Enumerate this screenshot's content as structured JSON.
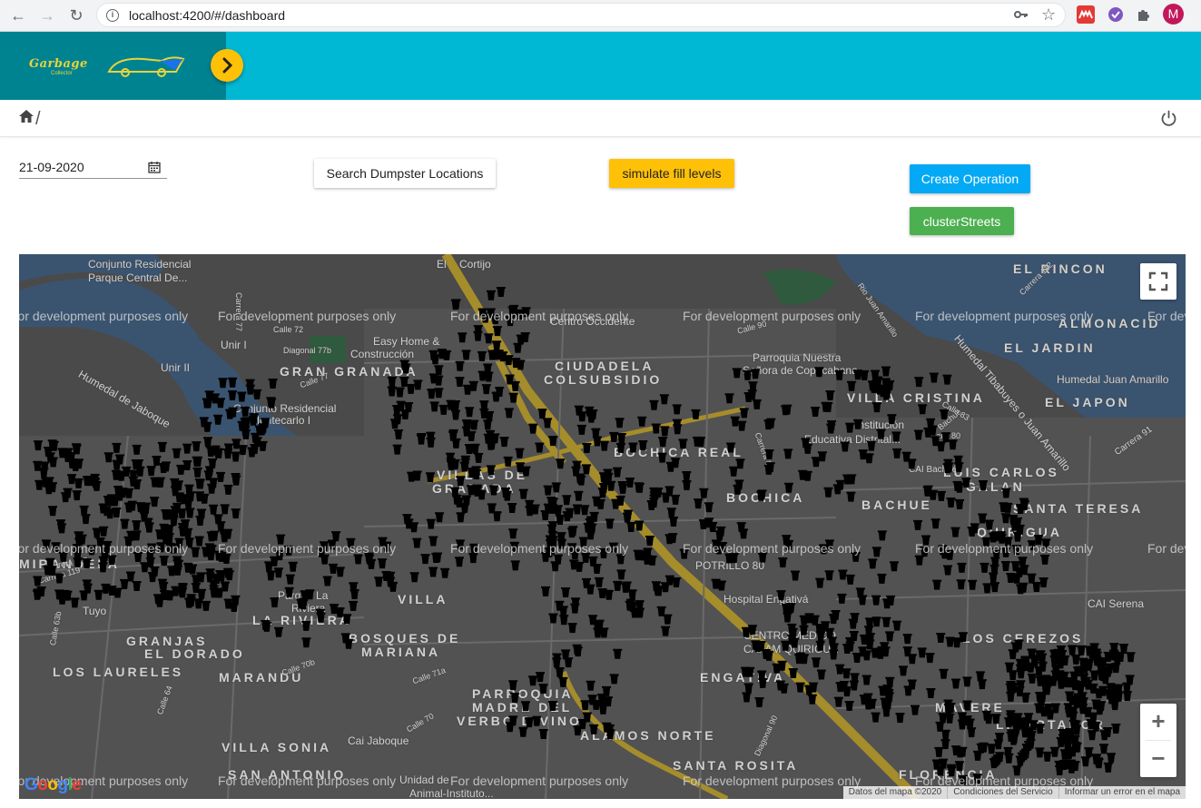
{
  "browser": {
    "url": "localhost:4200/#/dashboard",
    "profile_initial": "M"
  },
  "header": {
    "logo_text": "Garbage",
    "logo_subtext": "Collector"
  },
  "controls": {
    "date_value": "21-09-2020",
    "search_label": "Search Dumpster Locations",
    "simulate_label": "simulate fill levels",
    "create_label": "Create Operation",
    "cluster_label": "clusterStreets"
  },
  "map": {
    "watermark": "For development purposes only",
    "neighborhoods": [
      "EL RINCON",
      "ALMONACID",
      "EL JARDIN",
      "EL JAPON",
      "GRAN GRANADA",
      "CIUDADELA",
      "COLSUBSIDIO",
      "VILLA CRISTINA",
      "LUIS CARLOS",
      "GALAN",
      "SANTA TERESA",
      "BOCHICA",
      "BACHUE",
      "QUIRIGUA",
      "LOS LAURELES",
      "GRANJAS",
      "EL DORADO",
      "MARANDU",
      "BOSQUES DE",
      "MARIANA",
      "VILLAS DE",
      "GRANADA",
      "PARROQUIA",
      "MADRE DEL",
      "VERBO DIVINO",
      "ALAMOS NORTE",
      "ENGATIVA",
      "VILLA SONIA",
      "SAN ANTONIO",
      "SANTA ROSITA",
      "LOS CEREZOS",
      "MAVERE",
      "FLORENCIA",
      "LIBERTADOR",
      "MIRANDELA",
      "LA RIVIERA",
      "VILLA",
      "BOCHICA REAL"
    ],
    "places": [
      "Conjunto Residencial",
      "Parque Central De...",
      "Humedal de Jaboque",
      "Easy Home &",
      "Construcción",
      "Unir II",
      "Conjunto Residencial",
      "Montecarlo I",
      "Calle 77",
      "Diagonal 77b",
      "Parroquia Nuestra",
      "Señora de Copacabana",
      "Humedal Juan Amarillo",
      "Institución",
      "Educativa Distrital...",
      "CAI Bachué",
      "Parque La",
      "Riviera",
      "Tuyo",
      "Cai Jaboque",
      "CAI Serena",
      "Hospital Engativá",
      "CENTRO MEDICO",
      "CAFAM QUIRIGUA",
      "POTRILLO 80",
      "Unidad de",
      "Animal-Instituto...",
      "Humedal Tibabuyes o Juan Amarillo",
      "Carrera 91",
      "Calle 63b",
      "Calle 64",
      "Calle 70",
      "Carrera 119",
      "Carrera 116",
      "Diagonal 90",
      "Calle 80",
      "Calle 72",
      "Calle 70b",
      "Calle 71a",
      "Carrera 77",
      "Carrera 86",
      "Bachué",
      "Rio Juan Amarillo",
      "Calle 90",
      "Carrera 112",
      "Calle 83",
      "Unir I",
      "Centro Occidente",
      "Cortijo",
      "El"
    ],
    "google_logo": "Google",
    "attribution": [
      "Datos del mapa ©2020",
      "Condiciones del Servicio",
      "Informar un error en el mapa"
    ],
    "zoom_in": "+",
    "zoom_out": "−"
  }
}
